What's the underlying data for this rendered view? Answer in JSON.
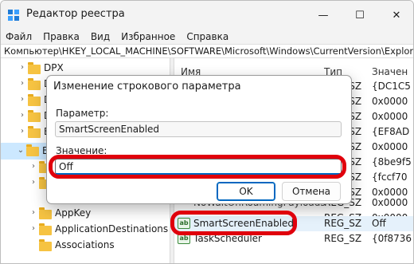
{
  "window": {
    "title": "Редактор реестра",
    "controls": {
      "minimize": "—",
      "maximize": "☐",
      "close": "✕"
    }
  },
  "menu": [
    "Файл",
    "Правка",
    "Вид",
    "Избранное",
    "Справка"
  ],
  "address": "Компьютер\\HKEY_LOCAL_MACHINE\\SOFTWARE\\Microsoft\\Windows\\CurrentVersion\\Explorer",
  "tree": {
    "items": [
      {
        "label": "DPX",
        "expanded": false
      },
      {
        "label": "D",
        "expanded": false
      },
      {
        "label": "D",
        "expanded": false
      },
      {
        "label": "D",
        "expanded": false
      },
      {
        "label": "E",
        "expanded": false
      },
      {
        "label": "E",
        "expanded": true,
        "selected": true
      },
      {
        "label": "",
        "expanded": false
      },
      {
        "label": "",
        "expanded": false
      },
      {
        "label": "AppKey",
        "expanded": false
      },
      {
        "label": "ApplicationDestinations",
        "expanded": false
      },
      {
        "label": "Associations",
        "expanded": false
      }
    ]
  },
  "list": {
    "columns": {
      "name": "Имя",
      "type": "Тип",
      "value": "Значен"
    },
    "rows": [
      {
        "name": "",
        "type": "REG_SZ",
        "value": "{DC1C5"
      },
      {
        "name": "",
        "type": "REG_SZ",
        "value": "0x0000"
      },
      {
        "name": "",
        "type": "REG_SZ",
        "value": "0x0000"
      },
      {
        "name": "",
        "type": "REG_SZ",
        "value": "{EF8AD"
      },
      {
        "name": "",
        "type": "REG_SZ",
        "value": "0x0000"
      },
      {
        "name": "",
        "type": "REG_SZ",
        "value": "{8be9f5"
      },
      {
        "name": "",
        "type": "REG_SZ",
        "value": "{fccf70"
      },
      {
        "name": "",
        "type": "REG_SZ",
        "value": "0x0000"
      },
      {
        "name": "",
        "type": "REG_SZ",
        "value": "0x0000"
      },
      {
        "name": "",
        "type": "REG_SZ",
        "value": "0x0000"
      },
      {
        "name": "SmartScreenEnabled",
        "type": "REG_SZ",
        "value": "Off",
        "icon": "string-value-icon"
      },
      {
        "name": "TaskScheduler",
        "type": "REG_SZ",
        "value": "{0f8736"
      }
    ],
    "partial_row_name": "NoWaitOnRoamingPayloads"
  },
  "dialog": {
    "title": "Изменение строкового параметра",
    "param_label": "Параметр:",
    "param_value": "SmartScreenEnabled",
    "value_label": "Значение:",
    "value": "Off",
    "ok": "OK",
    "cancel": "Отмена"
  },
  "colors": {
    "annotation": "#e0000c",
    "accent": "#0067c0",
    "folder": "#f6c342"
  }
}
